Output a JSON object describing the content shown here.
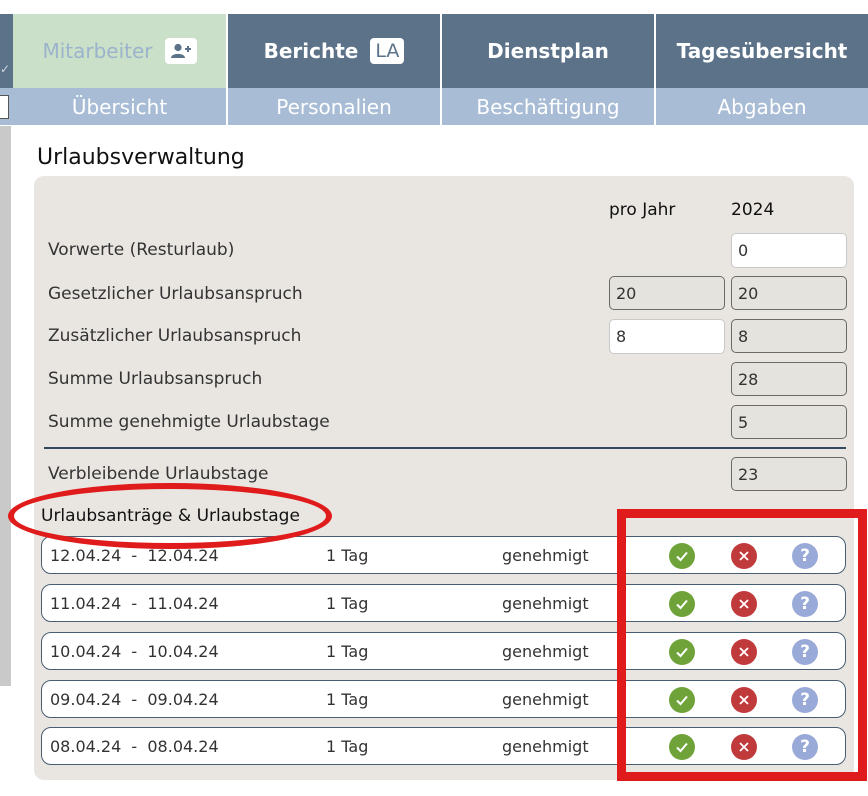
{
  "tabs": [
    {
      "label": "Mitarbeiter",
      "icon": "add-person-icon",
      "active": true
    },
    {
      "label": "Berichte",
      "badge": "LA"
    },
    {
      "label": "Dienstplan"
    },
    {
      "label": "Tagesübersicht"
    }
  ],
  "subtabs": [
    "Übersicht",
    "Personalien",
    "Beschäftigung",
    "Abgaben"
  ],
  "page_title": "Urlaubsverwaltung",
  "columns": {
    "per_year": "pro Jahr",
    "year": "2024"
  },
  "rows": [
    {
      "label": "Vorwerte (Resturlaub)",
      "year_value": "0"
    },
    {
      "label": "Gesetzlicher Urlaubsanspruch",
      "per_year_value": "20",
      "year_value": "20"
    },
    {
      "label": "Zusätzlicher Urlaubsanspruch",
      "per_year_value": "8",
      "year_value": "8"
    },
    {
      "label": "Summe Urlaubsanspruch",
      "year_value": "28"
    },
    {
      "label": "Summe genehmigte Urlaubstage",
      "year_value": "5"
    },
    {
      "label": "Verbleibende Urlaubstage",
      "year_value": "23"
    }
  ],
  "requests_heading": "Urlaubsanträge & Urlaubstage",
  "requests": [
    {
      "range": "12.04.24  -  12.04.24",
      "days": "1 Tag",
      "status": "genehmigt"
    },
    {
      "range": "11.04.24  -  11.04.24",
      "days": "1 Tag",
      "status": "genehmigt"
    },
    {
      "range": "10.04.24  -  10.04.24",
      "days": "1 Tag",
      "status": "genehmigt"
    },
    {
      "range": "09.04.24  -  09.04.24",
      "days": "1 Tag",
      "status": "genehmigt"
    },
    {
      "range": "08.04.24  -  08.04.24",
      "days": "1 Tag",
      "status": "genehmigt"
    }
  ],
  "action_icons": {
    "approve": "check-circle-icon",
    "reject": "x-circle-icon",
    "info": "question-circle-icon",
    "info_glyph": "?"
  },
  "colors": {
    "nav": "#5b7288",
    "subnav": "#a8bcd6",
    "active_tab": "#cbe0c8",
    "approve": "#6fa33a",
    "reject": "#c0393b",
    "info": "#9aaad8",
    "annotation": "#e01b1b"
  }
}
